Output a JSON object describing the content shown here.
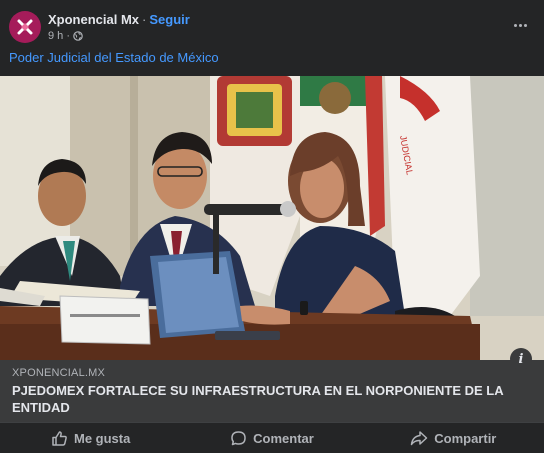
{
  "header": {
    "author": "Xponencial Mx",
    "separator": "·",
    "follow_label": "Seguir",
    "time": "9 h ·",
    "more_icon": "more-horizontal-icon",
    "privacy_icon": "globe-icon"
  },
  "post": {
    "text": "Poder Judicial del Estado de México"
  },
  "link_preview": {
    "domain": "XPONENCIAL.MX",
    "headline": "PJEDOMEX FORTALECE SU INFRAESTRUCTURA EN EL NORPONIENTE DE LA ENTIDAD",
    "info_icon": "info-icon"
  },
  "actions": {
    "like_label": "Me gusta",
    "comment_label": "Comentar",
    "share_label": "Compartir"
  },
  "colors": {
    "background": "#242526",
    "link_blue": "#4599ff",
    "preview_bg": "#3a3b3c",
    "avatar": "#a51c5a"
  }
}
